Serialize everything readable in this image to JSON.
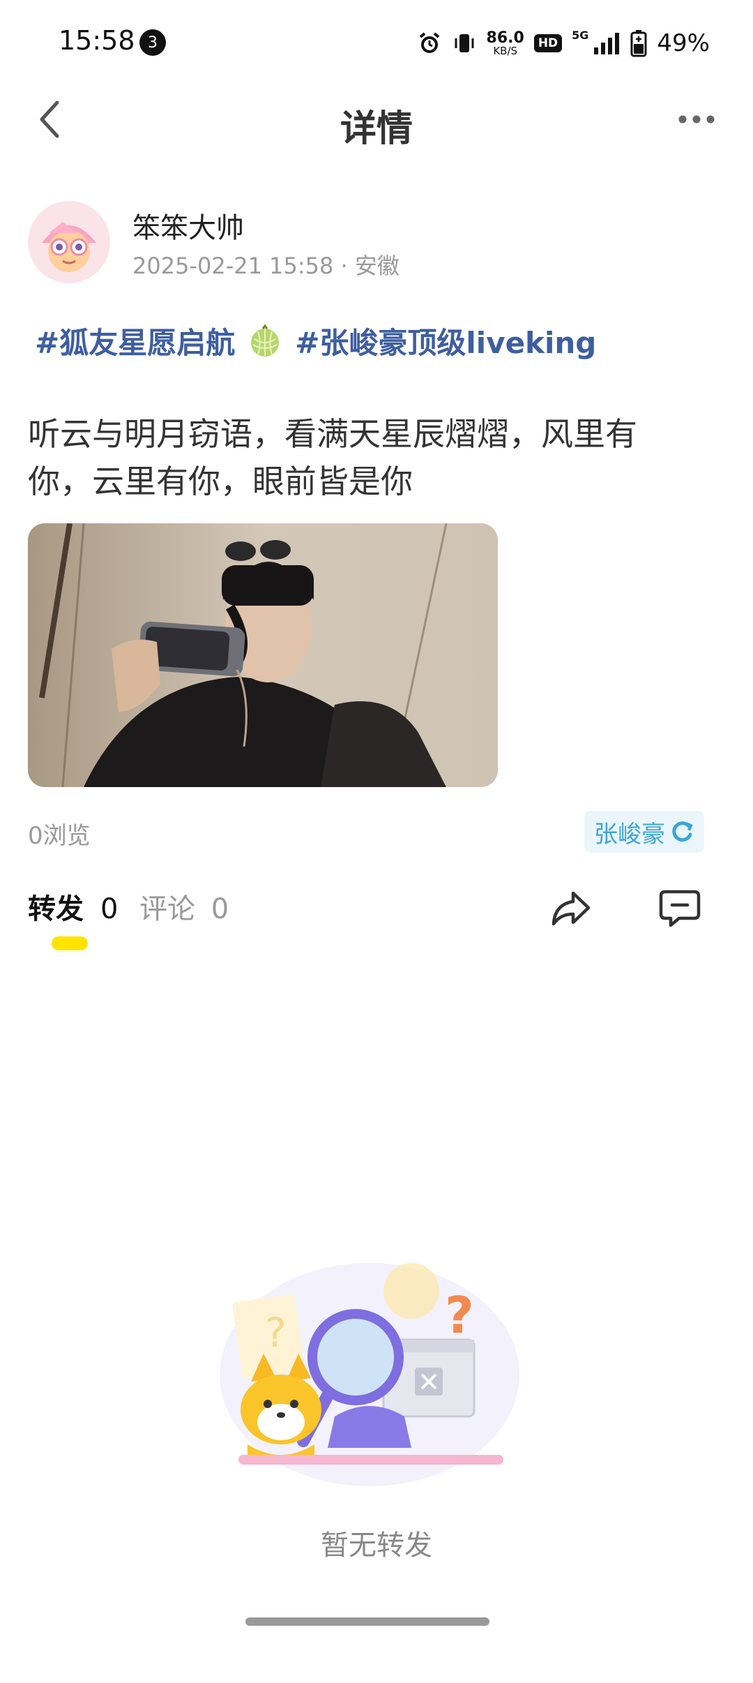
{
  "status_bar": {
    "time": "15:58",
    "notification_count": "3",
    "net_speed_value": "86.0",
    "net_speed_unit": "KB/S",
    "hd_label": "HD",
    "network_label": "5G",
    "battery_percent": "49%"
  },
  "header": {
    "title": "详情"
  },
  "post": {
    "author_name": "笨笨大帅",
    "meta": "2025-02-21 15:58 · 安徽",
    "topics": [
      "#狐友星愿启航",
      "#张峻豪顶级liveking"
    ],
    "text": "听云与明月窃语，看满天星辰熠熠，风里有你，云里有你，眼前皆是你",
    "views": "0浏览",
    "artist_tag": "张峻豪"
  },
  "tabs": {
    "forward_label": "转发",
    "forward_count": "0",
    "comment_label": "评论",
    "comment_count": "0"
  },
  "empty_state": {
    "text": "暂无转发"
  },
  "colors": {
    "topic": "#3e5ea0",
    "tab_indicator": "#ffe400",
    "artist_tag_text": "#3aa6d8",
    "artist_tag_bg": "#eaf6fb"
  },
  "icons": [
    "back-arrow-icon",
    "more-dots-icon",
    "melon-icon",
    "refresh-icon",
    "share-icon",
    "comment-icon",
    "alarm-icon",
    "vibrate-icon",
    "signal-icon",
    "battery-icon"
  ]
}
